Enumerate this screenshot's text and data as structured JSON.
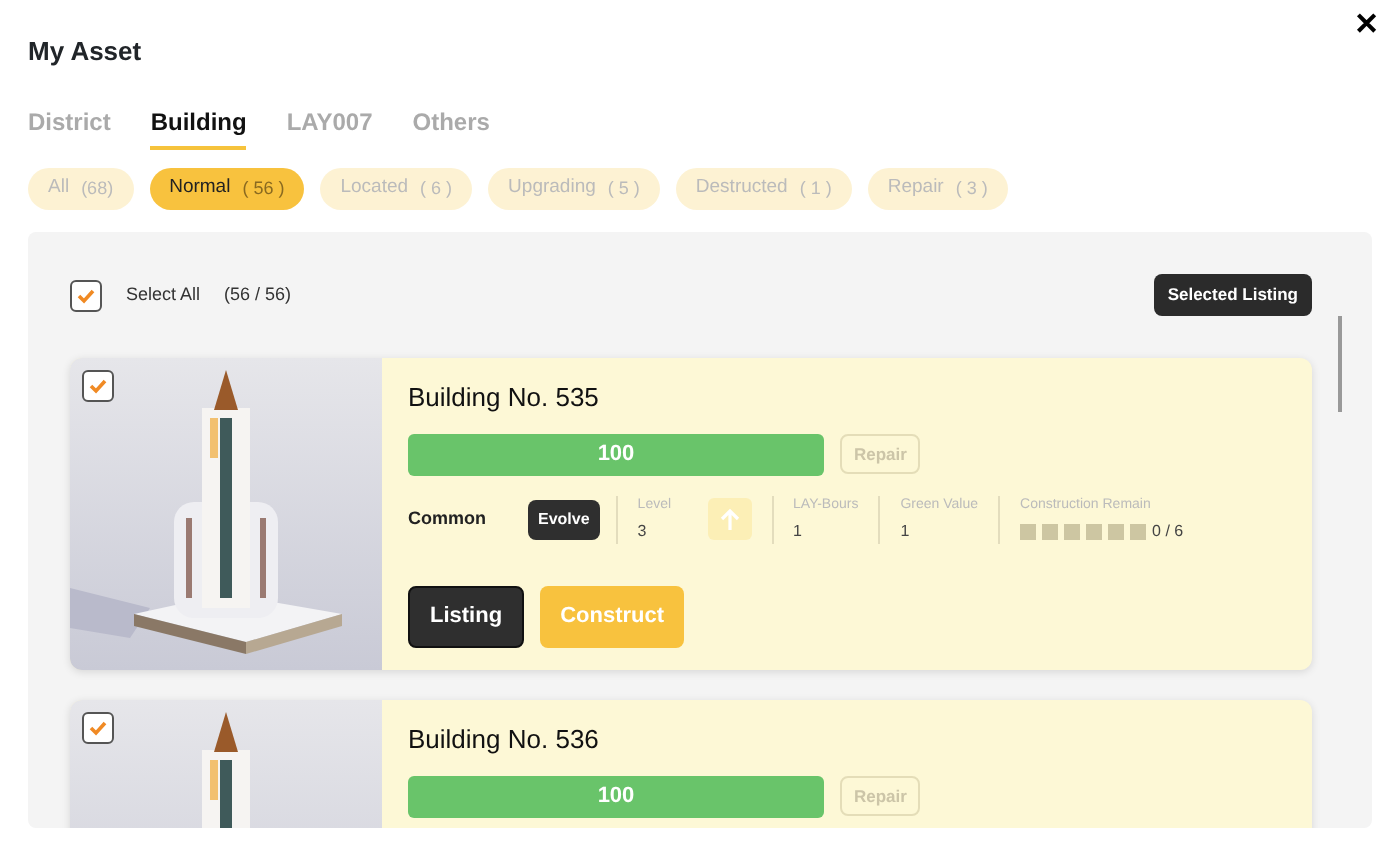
{
  "title": "My Asset",
  "close": "✕",
  "tabs": [
    {
      "label": "District",
      "selected": false
    },
    {
      "label": "Building",
      "selected": true
    },
    {
      "label": "LAY007",
      "selected": false
    },
    {
      "label": "Others",
      "selected": false
    }
  ],
  "filters": [
    {
      "label": "All",
      "count": "(68)",
      "selected": false
    },
    {
      "label": "Normal",
      "count": "( 56 )",
      "selected": true
    },
    {
      "label": "Located",
      "count": "( 6 )",
      "selected": false
    },
    {
      "label": "Upgrading",
      "count": "( 5 )",
      "selected": false
    },
    {
      "label": "Destructed",
      "count": "( 1 )",
      "selected": false
    },
    {
      "label": "Repair",
      "count": "( 3 )",
      "selected": false
    }
  ],
  "select_all": {
    "label": "Select All",
    "count": "(56 / 56)",
    "checked": true
  },
  "selected_listing": "Selected Listing",
  "buildings": [
    {
      "name": "Building No. 535",
      "checked": true,
      "durability": "100",
      "level": 1.0,
      "repair": "Repair",
      "repair_disabled": true,
      "rarity": "Common",
      "evolve": "Evolve",
      "stats": [
        {
          "kind": "text",
          "label": "Level",
          "value": "3"
        },
        {
          "kind": "upgrade",
          "disabled": true
        },
        {
          "kind": "text",
          "label": "LAY-Bours",
          "value": "1"
        },
        {
          "kind": "text",
          "label": "Green Value",
          "value": "1"
        },
        {
          "kind": "progress",
          "label": "Construction Remain",
          "value": "0 / 6"
        }
      ],
      "actions": [
        {
          "label": "Listing",
          "kind": "dark"
        },
        {
          "label": "Construct",
          "kind": "yellow"
        }
      ]
    },
    {
      "name": "Building No. 536",
      "checked": true,
      "durability": "100",
      "level": 1.0,
      "repair": "Repair",
      "repair_disabled": true
    }
  ]
}
